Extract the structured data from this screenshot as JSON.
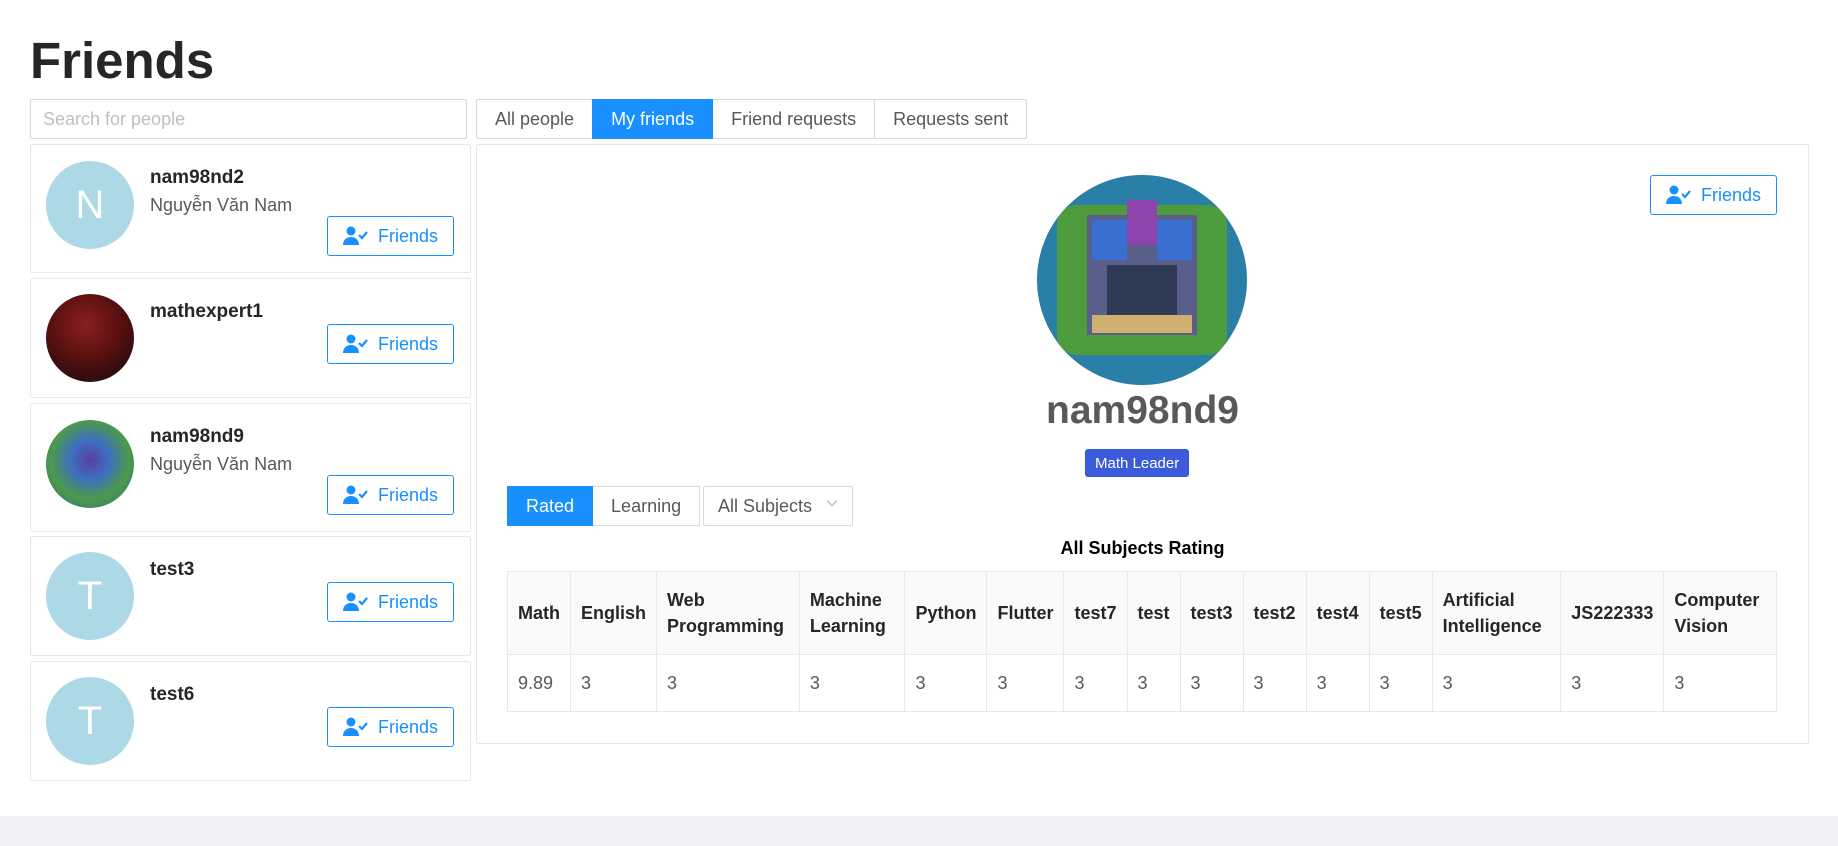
{
  "page": {
    "title": "Friends"
  },
  "search": {
    "placeholder": "Search for people",
    "value": ""
  },
  "tabs": [
    {
      "label": "All people",
      "active": false
    },
    {
      "label": "My friends",
      "active": true
    },
    {
      "label": "Friend requests",
      "active": false
    },
    {
      "label": "Requests sent",
      "active": false
    }
  ],
  "friends": [
    {
      "username": "nam98nd2",
      "full_name": "Nguyễn Văn Nam",
      "avatar_letter": "N",
      "avatar_kind": "letter",
      "button": "Friends"
    },
    {
      "username": "mathexpert1",
      "full_name": "",
      "avatar_letter": "",
      "avatar_kind": "photo-dark",
      "button": "Friends"
    },
    {
      "username": "nam98nd9",
      "full_name": "Nguyễn Văn Nam",
      "avatar_letter": "",
      "avatar_kind": "photo-game",
      "button": "Friends"
    },
    {
      "username": "test3",
      "full_name": "",
      "avatar_letter": "T",
      "avatar_kind": "letter",
      "button": "Friends"
    },
    {
      "username": "test6",
      "full_name": "",
      "avatar_letter": "T",
      "avatar_kind": "letter",
      "button": "Friends"
    }
  ],
  "profile": {
    "username": "nam98nd9",
    "badge": "Math Leader",
    "friends_button": "Friends",
    "rating_tabs": [
      {
        "label": "Rated",
        "active": true
      },
      {
        "label": "Learning",
        "active": false
      }
    ],
    "subject_select": "All Subjects",
    "table_title": "All Subjects Rating",
    "table": {
      "headers": [
        "Math",
        "English",
        "Web Programming",
        "Machine Learning",
        "Python",
        "Flutter",
        "test7",
        "test",
        "test3",
        "test2",
        "test4",
        "test5",
        "Artificial Intelligence",
        "JS222333",
        "Computer Vision"
      ],
      "rows": [
        [
          "9.89",
          "3",
          "3",
          "3",
          "3",
          "3",
          "3",
          "3",
          "3",
          "3",
          "3",
          "3",
          "3",
          "3",
          "3"
        ]
      ]
    }
  },
  "colors": {
    "accent": "#1890ff",
    "badge": "#3b5bdb",
    "avatar_letter_bg": "#add8e6",
    "footer": "#f0f2f5"
  },
  "icons": {
    "friend_button_icon": "user-check-icon",
    "select_icon": "chevron-down-icon"
  }
}
